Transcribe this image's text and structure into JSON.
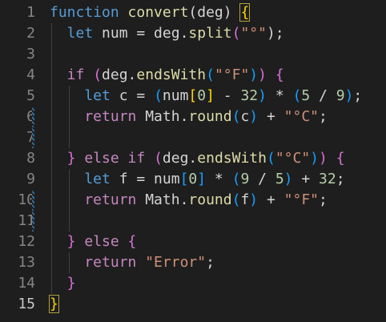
{
  "editor": {
    "language": "javascript",
    "active_line": 15,
    "lines": [
      {
        "n": "1",
        "tokens": [
          {
            "t": "function ",
            "c": "#569cd6"
          },
          {
            "t": "convert",
            "c": "#dcdcaa"
          },
          {
            "t": "(deg) ",
            "c": "#d4d4d4"
          },
          {
            "t": "{",
            "c": "#ffd700",
            "hl": true
          }
        ]
      },
      {
        "n": "2",
        "tokens": [
          {
            "t": "  let ",
            "c": "#569cd6"
          },
          {
            "t": "num = deg.",
            "c": "#d4d4d4"
          },
          {
            "t": "split",
            "c": "#dcdcaa"
          },
          {
            "t": "(",
            "c": "#da70d6"
          },
          {
            "t": "\"°\"",
            "c": "#ce9178"
          },
          {
            "t": ");",
            "c": "#d4d4d4"
          }
        ]
      },
      {
        "n": "3",
        "tokens": []
      },
      {
        "n": "4",
        "tokens": [
          {
            "t": "  if ",
            "c": "#c586c0"
          },
          {
            "t": "(",
            "c": "#da70d6"
          },
          {
            "t": "deg.",
            "c": "#d4d4d4"
          },
          {
            "t": "endsWith",
            "c": "#dcdcaa"
          },
          {
            "t": "(",
            "c": "#179fff"
          },
          {
            "t": "\"°F\"",
            "c": "#ce9178"
          },
          {
            "t": ")",
            "c": "#179fff"
          },
          {
            "t": ") ",
            "c": "#da70d6"
          },
          {
            "t": "{",
            "c": "#da70d6"
          }
        ]
      },
      {
        "n": "5",
        "tokens": [
          {
            "t": "    let ",
            "c": "#569cd6"
          },
          {
            "t": "c = ",
            "c": "#d4d4d4"
          },
          {
            "t": "(",
            "c": "#179fff"
          },
          {
            "t": "num",
            "c": "#d4d4d4"
          },
          {
            "t": "[",
            "c": "#ffd700"
          },
          {
            "t": "0",
            "c": "#b5cea8"
          },
          {
            "t": "]",
            "c": "#ffd700"
          },
          {
            "t": " - ",
            "c": "#d4d4d4"
          },
          {
            "t": "32",
            "c": "#b5cea8"
          },
          {
            "t": ")",
            "c": "#179fff"
          },
          {
            "t": " * ",
            "c": "#d4d4d4"
          },
          {
            "t": "(",
            "c": "#179fff"
          },
          {
            "t": "5",
            "c": "#b5cea8"
          },
          {
            "t": " / ",
            "c": "#d4d4d4"
          },
          {
            "t": "9",
            "c": "#b5cea8"
          },
          {
            "t": ")",
            "c": "#179fff"
          },
          {
            "t": ";",
            "c": "#d4d4d4"
          }
        ]
      },
      {
        "n": "6",
        "tokens": [
          {
            "t": "    return ",
            "c": "#c586c0"
          },
          {
            "t": "Math.",
            "c": "#d4d4d4"
          },
          {
            "t": "round",
            "c": "#dcdcaa"
          },
          {
            "t": "(",
            "c": "#179fff"
          },
          {
            "t": "c",
            "c": "#d4d4d4"
          },
          {
            "t": ")",
            "c": "#179fff"
          },
          {
            "t": " + ",
            "c": "#d4d4d4"
          },
          {
            "t": "\"°C\"",
            "c": "#ce9178"
          },
          {
            "t": ";",
            "c": "#d4d4d4"
          }
        ]
      },
      {
        "n": "7",
        "tokens": []
      },
      {
        "n": "8",
        "tokens": [
          {
            "t": "  } ",
            "c": "#da70d6"
          },
          {
            "t": "else if ",
            "c": "#c586c0"
          },
          {
            "t": "(",
            "c": "#da70d6"
          },
          {
            "t": "deg.",
            "c": "#d4d4d4"
          },
          {
            "t": "endsWith",
            "c": "#dcdcaa"
          },
          {
            "t": "(",
            "c": "#179fff"
          },
          {
            "t": "\"°C\"",
            "c": "#ce9178"
          },
          {
            "t": ")",
            "c": "#179fff"
          },
          {
            "t": ") ",
            "c": "#da70d6"
          },
          {
            "t": "{",
            "c": "#da70d6"
          }
        ]
      },
      {
        "n": "9",
        "tokens": [
          {
            "t": "    let ",
            "c": "#569cd6"
          },
          {
            "t": "f = num",
            "c": "#d4d4d4"
          },
          {
            "t": "[",
            "c": "#179fff"
          },
          {
            "t": "0",
            "c": "#b5cea8"
          },
          {
            "t": "]",
            "c": "#179fff"
          },
          {
            "t": " * ",
            "c": "#d4d4d4"
          },
          {
            "t": "(",
            "c": "#179fff"
          },
          {
            "t": "9",
            "c": "#b5cea8"
          },
          {
            "t": " / ",
            "c": "#d4d4d4"
          },
          {
            "t": "5",
            "c": "#b5cea8"
          },
          {
            "t": ")",
            "c": "#179fff"
          },
          {
            "t": " + ",
            "c": "#d4d4d4"
          },
          {
            "t": "32",
            "c": "#b5cea8"
          },
          {
            "t": ";",
            "c": "#d4d4d4"
          }
        ]
      },
      {
        "n": "10",
        "tokens": [
          {
            "t": "    return ",
            "c": "#c586c0"
          },
          {
            "t": "Math.",
            "c": "#d4d4d4"
          },
          {
            "t": "round",
            "c": "#dcdcaa"
          },
          {
            "t": "(",
            "c": "#179fff"
          },
          {
            "t": "f",
            "c": "#d4d4d4"
          },
          {
            "t": ")",
            "c": "#179fff"
          },
          {
            "t": " + ",
            "c": "#d4d4d4"
          },
          {
            "t": "\"°F\"",
            "c": "#ce9178"
          },
          {
            "t": ";",
            "c": "#d4d4d4"
          }
        ]
      },
      {
        "n": "11",
        "tokens": []
      },
      {
        "n": "12",
        "tokens": [
          {
            "t": "  } ",
            "c": "#da70d6"
          },
          {
            "t": "else ",
            "c": "#c586c0"
          },
          {
            "t": "{",
            "c": "#da70d6"
          }
        ]
      },
      {
        "n": "13",
        "tokens": [
          {
            "t": "    return ",
            "c": "#c586c0"
          },
          {
            "t": "\"Error\"",
            "c": "#ce9178"
          },
          {
            "t": ";",
            "c": "#d4d4d4"
          }
        ]
      },
      {
        "n": "14",
        "tokens": [
          {
            "t": "  }",
            "c": "#da70d6"
          }
        ]
      },
      {
        "n": "15",
        "tokens": [
          {
            "t": "}",
            "c": "#ffd700",
            "hl": true
          }
        ]
      }
    ],
    "git_modified_lines": [
      6,
      7,
      10,
      11
    ]
  }
}
